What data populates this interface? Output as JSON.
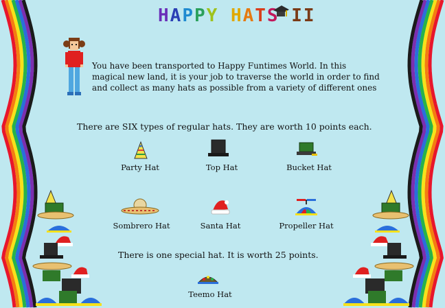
{
  "header": {
    "title_letters": [
      "H",
      "A",
      "P",
      "P",
      "Y",
      " ",
      "H",
      "A",
      "T",
      "S",
      " ",
      "I",
      "I"
    ],
    "title_colors": [
      "#6a2fb8",
      "#2a3fb5",
      "#1f8bd0",
      "#2aa05a",
      "#9ec21c",
      " ",
      "#e0a800",
      "#e57a11",
      "#d93d1a",
      "#c2185b",
      " ",
      "#7a3a16",
      "#7a3a16"
    ]
  },
  "intro": {
    "text": "You have been transported to Happy Funtimes World. In this magical new land, it is your job to traverse the world in order to find and collect as many hats as possible from a variety of different ones"
  },
  "regular": {
    "heading": "There are SIX types of regular hats.  They are worth 10 points each.",
    "hats": [
      {
        "label": "Party Hat",
        "icon": "party-hat-icon"
      },
      {
        "label": "Top Hat",
        "icon": "top-hat-icon"
      },
      {
        "label": "Bucket Hat",
        "icon": "bucket-hat-icon"
      },
      {
        "label": "Sombrero Hat",
        "icon": "sombrero-hat-icon"
      },
      {
        "label": "Santa Hat",
        "icon": "santa-hat-icon"
      },
      {
        "label": "Propeller Hat",
        "icon": "propeller-hat-icon"
      }
    ]
  },
  "special": {
    "heading": "There is one special hat.  It is worth 25 points.",
    "hat": {
      "label": "Teemo Hat",
      "icon": "teemo-hat-icon"
    }
  },
  "colors": {
    "background": "#bfe8f0",
    "rainbow": [
      "#e8162b",
      "#f47c12",
      "#f7e11a",
      "#27b34a",
      "#2a6fdb",
      "#7b2fb0",
      "#1a1a1a"
    ]
  }
}
